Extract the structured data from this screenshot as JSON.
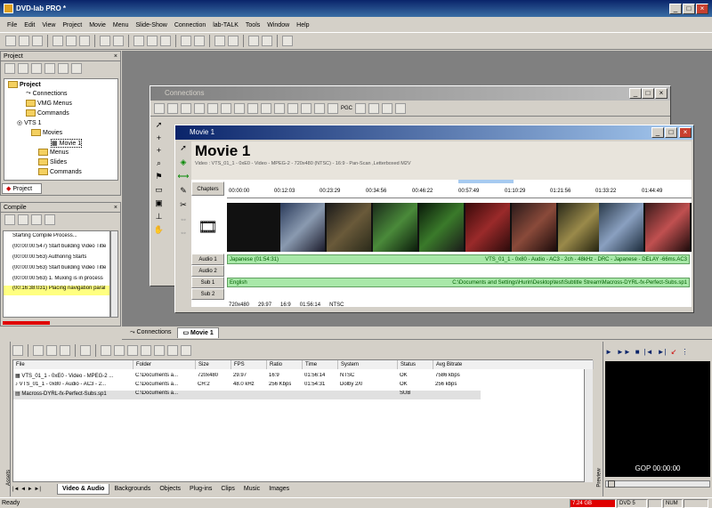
{
  "app": {
    "title": "DVD-lab PRO *"
  },
  "menu": [
    "File",
    "Edit",
    "View",
    "Project",
    "Movie",
    "Menu",
    "Slide-Show",
    "Connection",
    "lab-TALK",
    "Tools",
    "Window",
    "Help"
  ],
  "project_panel": {
    "title": "Project",
    "tab": "Project",
    "tree": {
      "root": "Project",
      "connections": "Connections",
      "vmg_menus": "VMG Menus",
      "commands": "Commands",
      "vts": "VTS 1",
      "movies": "Movies",
      "movie1": "Movie 1",
      "menus": "Menus",
      "slides": "Slides",
      "vts_commands": "Commands"
    }
  },
  "compile_panel": {
    "title": "Compile",
    "lines": [
      "Starting Compile Process...",
      "(00:00:00:547) Start building Video Title",
      "(00:00:00:563) Authoring Starts",
      "(00:00:00:563) Start building Video Title",
      "(00:00:00:563) 1. Muxing is in process",
      "(00:16:38:031) Placing navigation paral"
    ]
  },
  "connections_window": {
    "title": "Connections",
    "pgc_label": "PGC"
  },
  "movie_window": {
    "title": "Movie 1",
    "heading": "Movie 1",
    "subtitle": "Video : VTS_01_1 - 0xE0 - Video - MPEG-2 - 720x480 (NTSC) - 16:9 - Pan-Scan ,Letterboxed M2V",
    "chapters_label": "Chapters",
    "timecodes": [
      "00:00:00",
      "00:12:03",
      "00:23:29",
      "00:34:56",
      "00:46:22",
      "00:57:49",
      "01:10:29",
      "01:21:56",
      "01:33:22",
      "01:44:49"
    ],
    "audio1_label": "Audio 1",
    "audio2_label": "Audio 2",
    "sub1_label": "Sub 1",
    "sub2_label": "Sub 2",
    "audio1_left": "Japanese (01:54:31)",
    "audio1_right": "VTS_01_1 - 0x80 - Audio - AC3 - 2ch - 48kHz - DRC - Japanese - DELAY -66ms.AC3",
    "sub1_left": "English",
    "sub1_right": "C:\\Documents and Settings\\Hurin\\Desktop\\test\\Subtitle Stream\\Macross-DYRL-fx-Perfect-Subs.sp1",
    "footer": [
      "720x480",
      "29.97",
      "16:9",
      "01:56:14",
      "NTSC"
    ]
  },
  "bottom_tabs": {
    "connections": "Connections",
    "movie1": "Movie 1"
  },
  "assets": {
    "side_label": "Assets",
    "columns": [
      "File",
      "Folder",
      "Size",
      "FPS",
      "Ratio",
      "Time",
      "System",
      "Status",
      "Avg Bitrate"
    ],
    "rows": [
      [
        "VTS_01_1 - 0xE0 - Video - MPEG-2 ...",
        "C:\\Documents a...",
        "720x480",
        "29.97",
        "16:9",
        "01:56:14",
        "NTSC",
        "OK",
        "7586 kbps"
      ],
      [
        "VTS_01_1 - 0x80 - Audio - AC3 - 2...",
        "C:\\Documents a...",
        "CH:2",
        "48.0 kHz",
        "256 Kbps",
        "01:54:31",
        "Dolby 2/0",
        "OK",
        "256 kbps"
      ],
      [
        "Macross-DYRL-fx-Perfect-Subs.sp1",
        "C:\\Documents a...",
        "",
        "",
        "",
        "",
        "",
        "SUB",
        ""
      ]
    ],
    "tabs": [
      "Video & Audio",
      "Backgrounds",
      "Objects",
      "Plug-ins",
      "Clips",
      "Music",
      "Images"
    ]
  },
  "preview": {
    "side_label": "Preview",
    "gop": "GOP 00:00:00"
  },
  "status": {
    "left": "Ready",
    "size": "7.24 GB",
    "disc": "DVD 5",
    "num": "NUM"
  },
  "colors": {
    "title_blue": "#0a246a",
    "track_green": "#a8e8a8",
    "capacity_red": "#e00000",
    "highlight_yellow": "#ffff80"
  }
}
